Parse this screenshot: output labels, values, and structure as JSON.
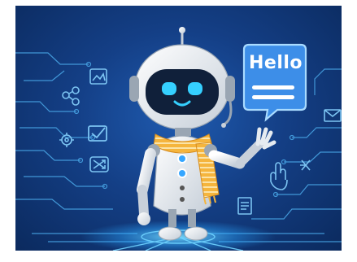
{
  "speech_bubble": {
    "text": "Hello"
  },
  "icons": [
    "share-icon",
    "picture-icon",
    "gear-icon",
    "check-icon",
    "shuffle-icon",
    "hand-cursor-icon",
    "document-icon",
    "envelope-icon",
    "link-icon"
  ],
  "colors": {
    "background": "#143f86",
    "circuit_lines": "#4aa8e8",
    "bubble": "#3d8ee8",
    "scarf": "#f5b53d",
    "robot_body": "#f2f5f8",
    "visor": "#10203a",
    "eyes": "#35d0ff"
  }
}
